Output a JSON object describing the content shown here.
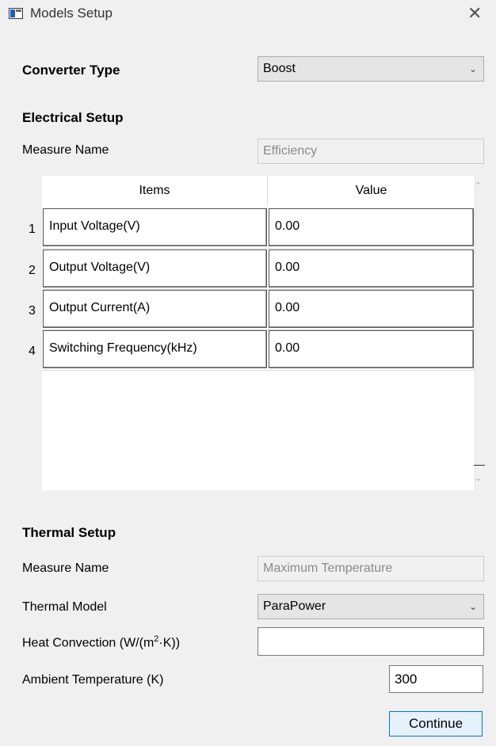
{
  "window": {
    "title": "Models Setup",
    "close_glyph": "✕"
  },
  "converter": {
    "label": "Converter Type",
    "value": "Boost"
  },
  "electrical": {
    "heading": "Electrical Setup",
    "measure_label": "Measure Name",
    "measure_value": "Efficiency",
    "table": {
      "headers": [
        "Items",
        "Value"
      ],
      "rows": [
        {
          "num": "1",
          "item": "Input Voltage(V)",
          "value": "0.00"
        },
        {
          "num": "2",
          "item": "Output Voltage(V)",
          "value": "0.00"
        },
        {
          "num": "3",
          "item": "Output Current(A)",
          "value": "0.00"
        },
        {
          "num": "4",
          "item": "Switching Frequency(kHz)",
          "value": "0.00"
        }
      ]
    }
  },
  "thermal": {
    "heading": "Thermal Setup",
    "measure_label": "Measure Name",
    "measure_value": "Maximum Temperature",
    "model_label": "Thermal Model",
    "model_value": "ParaPower",
    "convection_label_pre": "Heat Convection (W/(m",
    "convection_label_sup": "2",
    "convection_label_post": "·K))",
    "convection_value": "",
    "ambient_label": "Ambient Temperature (K)",
    "ambient_value": "300"
  },
  "actions": {
    "continue_label": "Continue"
  },
  "icons": {
    "dropdown": "chevron-down-icon",
    "scroll_up": "chevron-up-icon",
    "scroll_down": "chevron-down-icon"
  }
}
